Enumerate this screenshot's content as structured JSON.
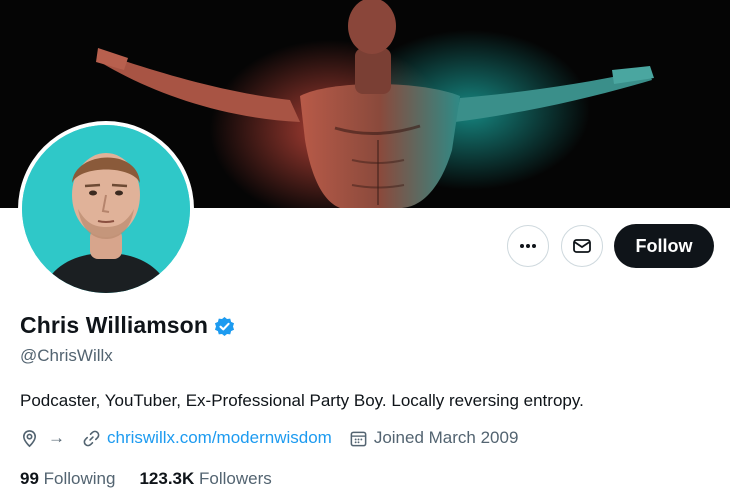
{
  "profile": {
    "display_name": "Chris Williamson",
    "handle": "@ChrisWillx",
    "bio": "Podcaster, YouTuber, Ex-Professional Party Boy. Locally reversing entropy.",
    "location_arrow": "→",
    "website": "chriswillx.com/modernwisdom",
    "joined": "Joined March 2009"
  },
  "actions": {
    "more_icon": "more-horizontal-icon",
    "mail_icon": "envelope-icon",
    "follow_label": "Follow"
  },
  "stats": {
    "following_count": "99",
    "following_label": "Following",
    "followers_count": "123.3K",
    "followers_label": "Followers"
  },
  "colors": {
    "follow_bg": "#0f1419",
    "link": "#1d9bf0",
    "verified": "#1d9bf0",
    "secondary_text": "#536471",
    "avatar_bg": "#2fc8c8"
  }
}
